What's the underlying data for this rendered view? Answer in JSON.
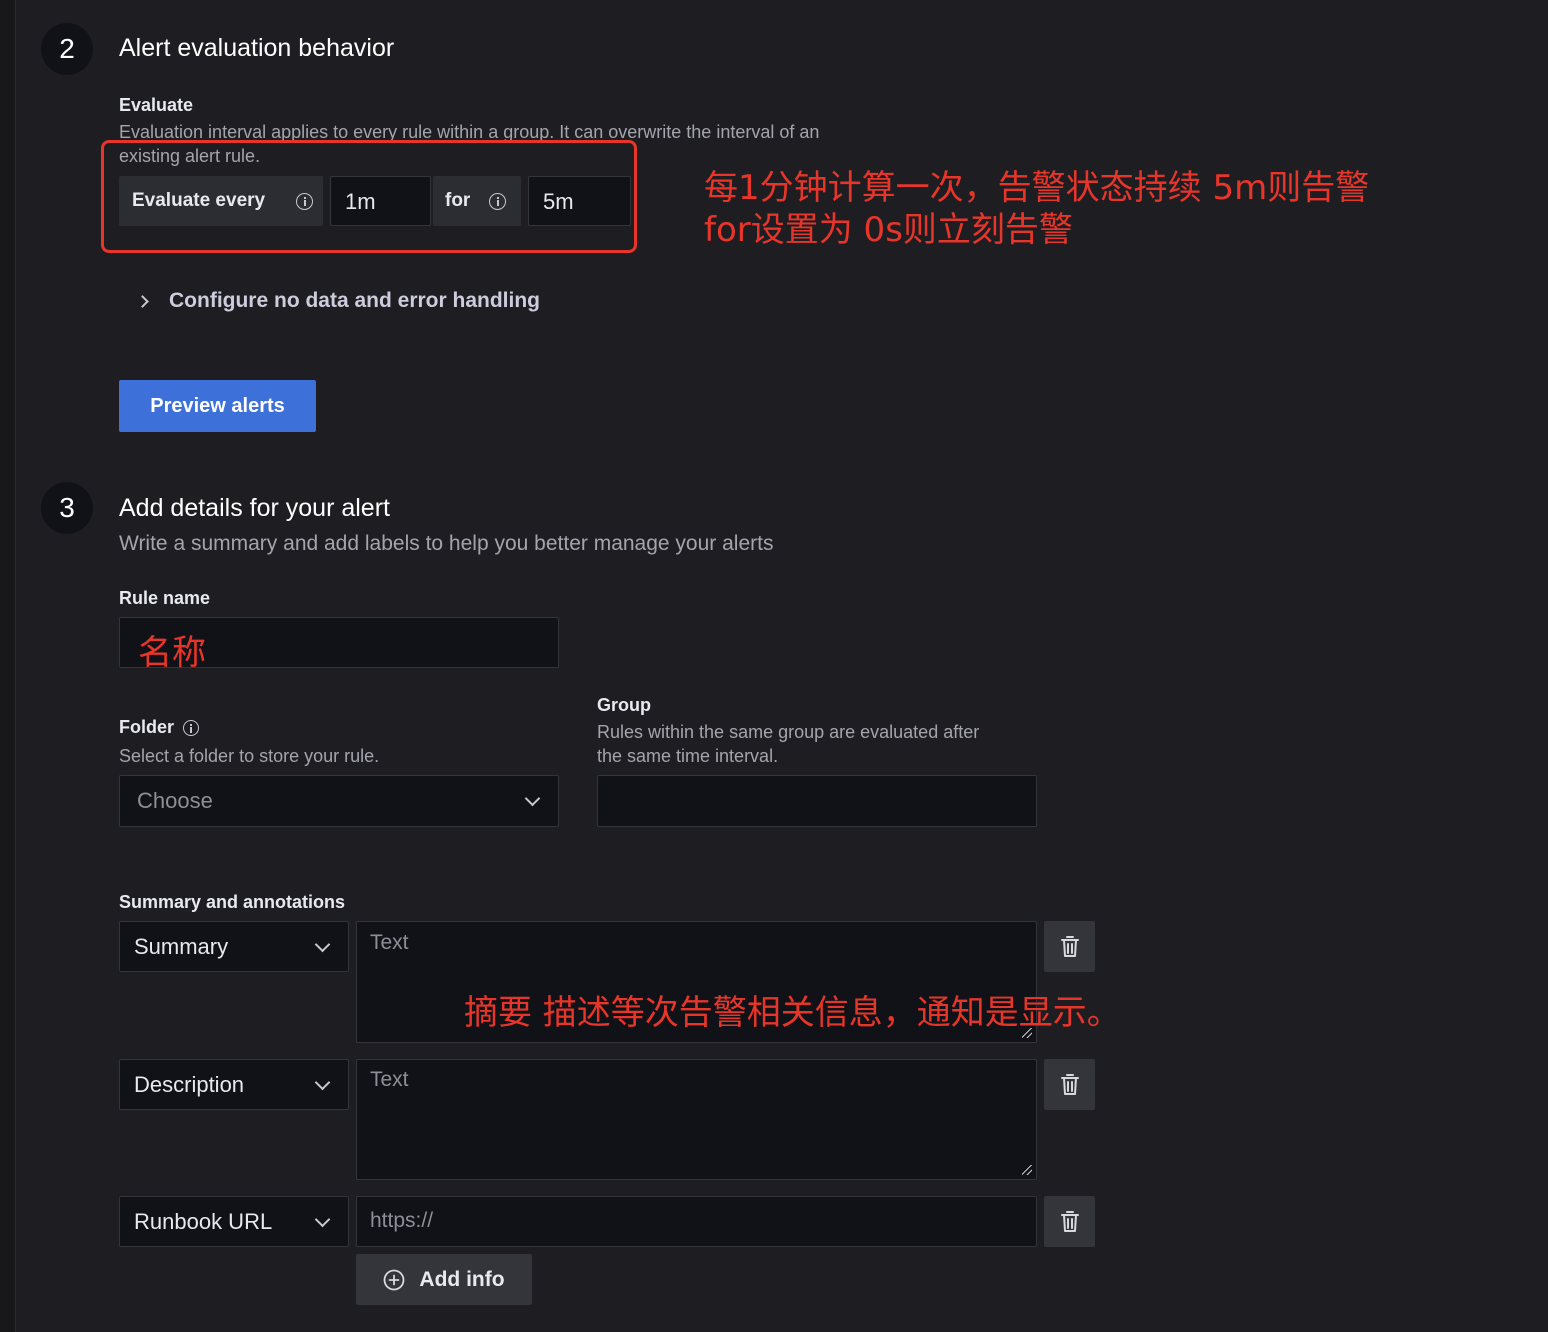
{
  "step2": {
    "number": "2",
    "title": "Alert evaluation behavior",
    "evaluate_label": "Evaluate",
    "evaluate_desc_line1": "Evaluation interval applies to every rule within a group. It can overwrite the interval of an",
    "evaluate_desc_line2": "existing alert rule.",
    "evaluate_every_label": "Evaluate every",
    "evaluate_every_value": "1m",
    "for_label": "for",
    "for_value": "5m",
    "configure_label": "Configure no data and error handling",
    "preview_button": "Preview alerts"
  },
  "annotations": {
    "evaluate_note_line1": "每1分钟计算一次，告警状态持续 5m则告警",
    "evaluate_note_line2": "for设置为 0s则立刻告警",
    "rule_name_note": "名称",
    "summary_note": "摘要 描述等次告警相关信息，通知是显示。",
    "color": "#e8352a"
  },
  "step3": {
    "number": "3",
    "title": "Add details for your alert",
    "subtitle": "Write a summary and add labels to help you better manage your alerts",
    "rule_name_label": "Rule name",
    "folder_label": "Folder",
    "folder_desc": "Select a folder to store your rule.",
    "folder_placeholder": "Choose",
    "group_label": "Group",
    "group_desc_line1": "Rules within the same group are evaluated after",
    "group_desc_line2": "the same time interval.",
    "summary_annotations_label": "Summary and annotations",
    "annotation_rows": [
      {
        "key": "Summary",
        "placeholder": "Text"
      },
      {
        "key": "Description",
        "placeholder": "Text"
      },
      {
        "key": "Runbook URL",
        "placeholder": "https://"
      }
    ],
    "add_info_button": "Add info"
  },
  "colors": {
    "background": "#1e1e22",
    "input_bg": "#111217",
    "primary_button": "#3d71d9",
    "annotation_red": "#e8352a"
  }
}
